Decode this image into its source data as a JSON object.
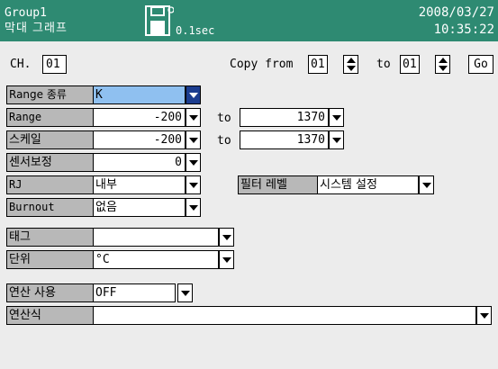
{
  "header": {
    "group": "Group1",
    "title": "막대 그래프",
    "interval": "0.1sec",
    "date": "2008/03/27",
    "time": "10:35:22"
  },
  "colors": {
    "header_bg": "#2e8a72",
    "selected_bg": "#8fc0f0",
    "label_bg": "#b8b8b8"
  },
  "icons": {
    "save": "floppy-disk-icon",
    "dropdown": "triangle-down",
    "spin": "up-down-arrows"
  },
  "channel": {
    "label": "CH.",
    "value": "01"
  },
  "copy": {
    "from_label": "Copy from",
    "from_value": "01",
    "to_label": "to",
    "to_value": "01",
    "go_label": "Go"
  },
  "input": {
    "range_type": {
      "label": "Range 종류",
      "value": "K"
    },
    "range": {
      "label": "Range",
      "from": "-200",
      "to_label": "to",
      "to": "1370"
    },
    "scale": {
      "label": "스케일",
      "from": "-200",
      "to_label": "to",
      "to": "1370"
    },
    "sensor_correction": {
      "label": "센서보정",
      "value": "0"
    },
    "rj": {
      "label": "RJ",
      "value": "내부"
    },
    "burnout": {
      "label": "Burnout",
      "value": "없음"
    }
  },
  "filter": {
    "label": "필터 레벨",
    "value": "시스템 설정"
  },
  "tag": {
    "label": "태그",
    "value": ""
  },
  "unit": {
    "label": "단위",
    "value": "°C"
  },
  "math": {
    "use_label": "연산 사용",
    "use_value": "OFF",
    "expr_label": "연산식",
    "expr_value": ""
  }
}
